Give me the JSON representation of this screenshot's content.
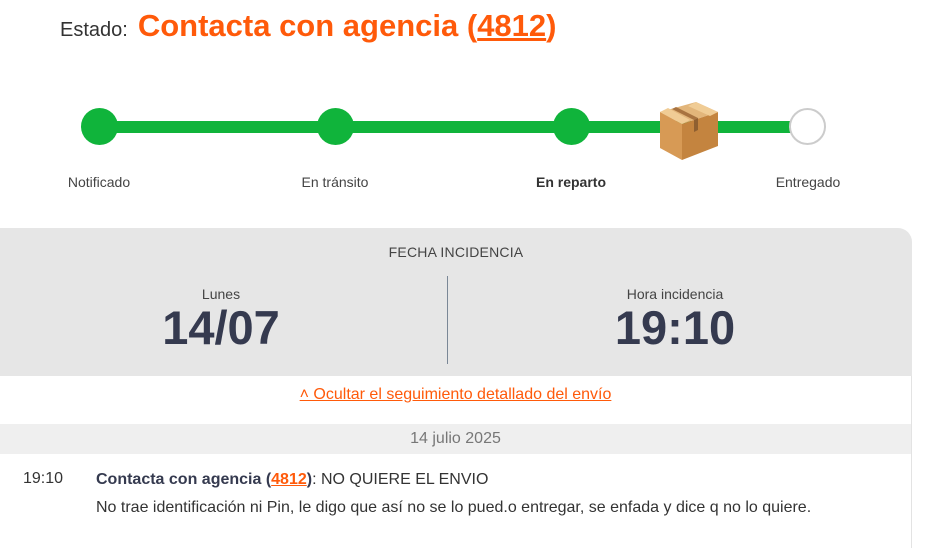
{
  "status": {
    "label": "Estado:",
    "title": "Contacta con agencia (",
    "code": "4812",
    "close": ")"
  },
  "tracker": {
    "steps": [
      {
        "label": "Notificado",
        "state": "done"
      },
      {
        "label": "En tránsito",
        "state": "done"
      },
      {
        "label": "En reparto",
        "state": "current"
      },
      {
        "label": "Entregado",
        "state": "pending"
      }
    ],
    "colors": {
      "done": "#10b43b",
      "pending": "#ffffff"
    }
  },
  "incident": {
    "title": "FECHA INCIDENCIA",
    "day_label": "Lunes",
    "date": "14/07",
    "time_label": "Hora incidencia",
    "time": "19:10"
  },
  "details": {
    "toggle": "˄ Ocultar el seguimiento detallado del envío",
    "date": "14 julio 2025",
    "entries": [
      {
        "time": "19:10",
        "status": "Contacta con agencia (",
        "code": "4812",
        "status_close": ")",
        "note": ": NO QUIERE EL ENVIO",
        "message": "No trae identificación ni Pin, le digo que así no se lo pued.o entregar, se enfada y dice q no lo quiere."
      }
    ]
  },
  "colors": {
    "accent": "#ff5a0a",
    "green": "#10b43b",
    "dark": "#353a4f"
  }
}
